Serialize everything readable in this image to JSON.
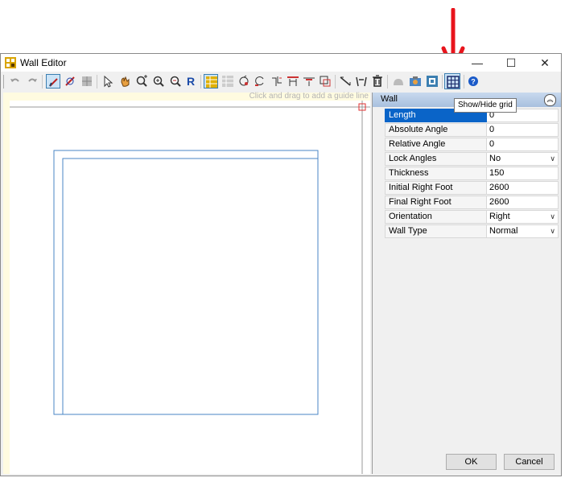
{
  "window": {
    "title": "Wall Editor",
    "controls": {
      "minimize": "—",
      "maximize": "☐",
      "close": "✕"
    }
  },
  "toolbar": {
    "buttons": [
      "undo-icon",
      "redo-icon",
      "draw-wall-icon",
      "delete-wall-icon",
      "hatch-icon",
      "select-pointer-icon",
      "pan-hand-icon",
      "zoom-plus-icon",
      "zoom-in-icon",
      "zoom-out-icon",
      "reset-view-icon",
      "wall-table-icon",
      "door-table-icon",
      "rotate-icon",
      "rotate-left-icon",
      "split-wall-icon",
      "align-top-icon",
      "align-bottom-icon",
      "offset-icon",
      "measure-icon",
      "trim-icon",
      "trash-icon",
      "shape-icon",
      "photo-icon",
      "texture-icon",
      "grid-icon",
      "help-icon"
    ]
  },
  "canvas": {
    "guide_hint": "Click and drag to add a guide line"
  },
  "properties": {
    "section": "Wall",
    "rows": [
      {
        "name": "Length",
        "value": "0",
        "selected": true
      },
      {
        "name": "Absolute Angle",
        "value": "0"
      },
      {
        "name": "Relative Angle",
        "value": "0"
      },
      {
        "name": "Lock Angles",
        "value": "No",
        "dropdown": true
      },
      {
        "name": "Thickness",
        "value": "150"
      },
      {
        "name": "Initial Right Foot",
        "value": "2600"
      },
      {
        "name": "Final Right Foot",
        "value": "2600"
      },
      {
        "name": "Orientation",
        "value": "Right",
        "dropdown": true
      },
      {
        "name": "Wall Type",
        "value": "Normal",
        "dropdown": true
      }
    ]
  },
  "tooltip": {
    "text": "Show/Hide grid"
  },
  "buttons": {
    "ok": "OK",
    "cancel": "Cancel"
  },
  "colors": {
    "annotation_arrow": "#e8141c",
    "selection": "#0a64c8",
    "wall_line": "#4a86c5"
  }
}
